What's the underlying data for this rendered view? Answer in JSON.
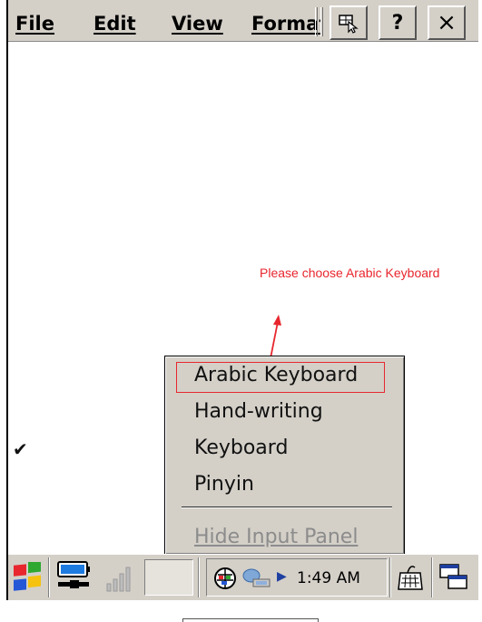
{
  "menubar": {
    "items": [
      {
        "label": "File"
      },
      {
        "label": "Edit"
      },
      {
        "label": "View"
      },
      {
        "label": "Format"
      }
    ],
    "buttons": {
      "input_panel_icon": "input-panel-icon",
      "help_label": "?",
      "close_label": "×"
    }
  },
  "annotation": {
    "text": "Please choose Arabic Keyboard",
    "color": "#e8262d"
  },
  "input_menu": {
    "items": [
      {
        "label": "Arabic Keyboard",
        "highlighted": true
      },
      {
        "label": "Hand-writing"
      },
      {
        "label": "Keyboard",
        "checked": true
      },
      {
        "label": "Pinyin"
      }
    ],
    "hide_label": "Hide Input Panel"
  },
  "taskbar": {
    "clock": "1:49 AM",
    "icons": [
      "windows-start-icon",
      "battery-power-icon",
      "signal-strength-icon",
      "network-globe-icon",
      "connection-icon",
      "tray-arrow-icon",
      "keyboard-icon",
      "desktop-windows-icon"
    ]
  }
}
